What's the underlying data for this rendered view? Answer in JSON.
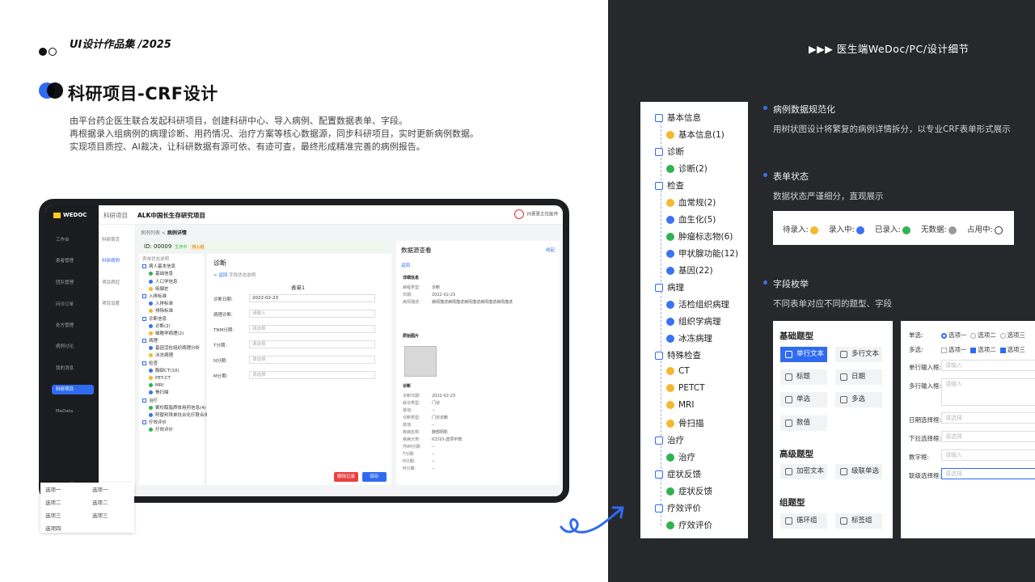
{
  "header": {
    "title": "UI设计作品集 /2025",
    "section_title": "科研项目-CRF设计",
    "intro": [
      "由平台药企医生联合发起科研项目，创建科研中心、导入病例、配置数据表单、字段。",
      "再根据录入组病例的病理诊断、用药情况、治疗方案等核心数据源，同步科研项目，实时更新病例数据。",
      "实现项目质控、AI裁决，让科研数据有源可依、有迹可查，最终形成精准完善的病例报告。"
    ]
  },
  "right_header": "医生端WeDoc/PC/设计细节",
  "app": {
    "logo": "WEDOC",
    "sidebar": [
      "工作台",
      "患者管理",
      "团队管理",
      "问诊订单",
      "处方管理",
      "病例讨论",
      "我的消息",
      "科研项目",
      "MeData"
    ],
    "breadcrumb_parent": "科研项目",
    "breadcrumb_current": "ALK中国长生存研究项目",
    "user": "孙惠惠主任医师",
    "subnav": [
      "科研首页",
      "科研病例",
      "项目质控",
      "项目设置"
    ],
    "sub_breadcrumb": [
      "病例列表",
      "病例详情"
    ],
    "id_label": "ID: 00009",
    "tag1": "生存中",
    "tag2": "待入组",
    "tree_header": "表单状态说明",
    "tree": [
      "病人基本信息",
      "基础信息",
      "人口学信息",
      "吸烟史",
      "入排标准",
      "入排标准",
      "排除标准",
      "诊断信息",
      "诊断(2)",
      "细胞学病理(2)",
      "病理",
      "基因活检组织病理分析",
      "冰冻病理",
      "检查",
      "胸部CT(10)",
      "PET-CT",
      "MRI",
      "骨扫描",
      "治疗",
      "紫杉醇脂质体用药信息(4)",
      "阿替利珠单抗合化疗联合用药(2)",
      "疗效评价",
      "疗效评价"
    ],
    "form_title": "诊断",
    "back": "返回",
    "form_hint": "字段状态说明",
    "form_name": "表单1",
    "fields": [
      {
        "label": "诊断日期:",
        "value": "2022-02-23"
      },
      {
        "label": "病理诊断:",
        "value": "请输入"
      },
      {
        "label": "TNM分期:",
        "value": "请选择"
      },
      {
        "label": "T分期:",
        "value": "请选择"
      },
      {
        "label": "N分期:",
        "value": "请选择"
      },
      {
        "label": "M分期:",
        "value": "请选择"
      }
    ],
    "btn_delete": "删除记录",
    "btn_save": "保存",
    "src_title": "数据源查看",
    "src_collapse": "收起",
    "src_detail": "详细信息",
    "src_kv1": [
      [
        "病程类型:",
        "诊断"
      ],
      [
        "日期:",
        "2022-02-23"
      ],
      [
        "病情描述:",
        "病情描述病情描述病情描述病情描述病情描述"
      ]
    ],
    "src_img": "原始图片",
    "src_diag": "诊断",
    "src_kv2": [
      [
        "诊断日期:",
        "2022-02-23"
      ],
      [
        "就诊类型:",
        "门诊"
      ],
      [
        "其他:",
        "--"
      ],
      [
        "诊断类型:",
        "门诊诊断"
      ],
      [
        "其他:",
        "--"
      ],
      [
        "疾病名称:",
        "肺部阴影"
      ],
      [
        "疾病分类:",
        "ICD10-选项字典"
      ],
      [
        "TNM分期:",
        "--"
      ],
      [
        "T分期:",
        "--"
      ],
      [
        "N分期:",
        "--"
      ],
      [
        "M分期:",
        "--"
      ]
    ]
  },
  "crf_tree": [
    {
      "label": "基本信息",
      "level": 0
    },
    {
      "label": "基本信息(1)",
      "level": 1,
      "status": "yellow"
    },
    {
      "label": "诊断",
      "level": 0
    },
    {
      "label": "诊断(2)",
      "level": 1,
      "status": "green"
    },
    {
      "label": "检查",
      "level": 0
    },
    {
      "label": "血常规(2)",
      "level": 1,
      "status": "yellow"
    },
    {
      "label": "血生化(5)",
      "level": 1,
      "status": "blue"
    },
    {
      "label": "肿瘤标志物(6)",
      "level": 1,
      "status": "green"
    },
    {
      "label": "甲状腺功能(12)",
      "level": 1,
      "status": "blue"
    },
    {
      "label": "基因(22)",
      "level": 1,
      "status": "blue"
    },
    {
      "label": "病理",
      "level": 0
    },
    {
      "label": "活检组织病理",
      "level": 1,
      "status": "blue"
    },
    {
      "label": "组织学病理",
      "level": 1,
      "status": "blue"
    },
    {
      "label": "冰冻病理",
      "level": 1,
      "status": "blue"
    },
    {
      "label": "特殊检查",
      "level": 0
    },
    {
      "label": "CT",
      "level": 1,
      "status": "yellow"
    },
    {
      "label": "PETCT",
      "level": 1,
      "status": "yellow"
    },
    {
      "label": "MRI",
      "level": 1,
      "status": "yellow"
    },
    {
      "label": "骨扫描",
      "level": 1,
      "status": "yellow"
    },
    {
      "label": "治疗",
      "level": 0
    },
    {
      "label": "治疗",
      "level": 1,
      "status": "green"
    },
    {
      "label": "症状反馈",
      "level": 0
    },
    {
      "label": "症状反馈",
      "level": 1,
      "status": "green"
    },
    {
      "label": "疗效评价",
      "level": 0
    },
    {
      "label": "疗效评价",
      "level": 1,
      "status": "green"
    }
  ],
  "features": [
    {
      "title": "病例数据规范化",
      "desc": "用树状图设计将繁复的病例详情拆分，以专业CRF表单形式展示"
    },
    {
      "title": "表单状态",
      "desc": "数据状态严谨细分，直观展示"
    },
    {
      "title": "字段枚举",
      "desc": "不同表单对应不同的题型、字段"
    }
  ],
  "status_legend": [
    "待录入:",
    "录入中:",
    "已录入:",
    "无数据:",
    "占用中:"
  ],
  "status_colors": {
    "yellow": "#f5b82e",
    "blue": "#3a72f0",
    "green": "#2eb350",
    "gray": "#999999"
  },
  "types": {
    "basic_title": "基础题型",
    "basic": [
      "单行文本",
      "多行文本",
      "标题",
      "日期",
      "单选",
      "多选",
      "数值"
    ],
    "adv_title": "高级题型",
    "adv": [
      "加密文本",
      "级联单选"
    ],
    "group_title": "组题型",
    "group": [
      "循环组",
      "标签组"
    ]
  },
  "field_demo": {
    "radio_label": "单选:",
    "check_label": "多选:",
    "options": [
      "选项一",
      "选项二",
      "选项三"
    ],
    "inputs": [
      {
        "label": "单行输入框:",
        "ph": "请输入"
      },
      {
        "label": "多行输入框:",
        "ph": "请输入"
      },
      {
        "label": "日期选择框:",
        "ph": "请选择"
      },
      {
        "label": "下拉选择框:",
        "ph": "请选择"
      },
      {
        "label": "数字框:",
        "ph": "请输入"
      },
      {
        "label": "联级选择框:",
        "ph": "请选择"
      }
    ],
    "cascade1": [
      "选项一",
      "选项二",
      "选项三",
      "选项四"
    ],
    "cascade2": [
      "选项一",
      "选项二",
      "选项三"
    ]
  }
}
